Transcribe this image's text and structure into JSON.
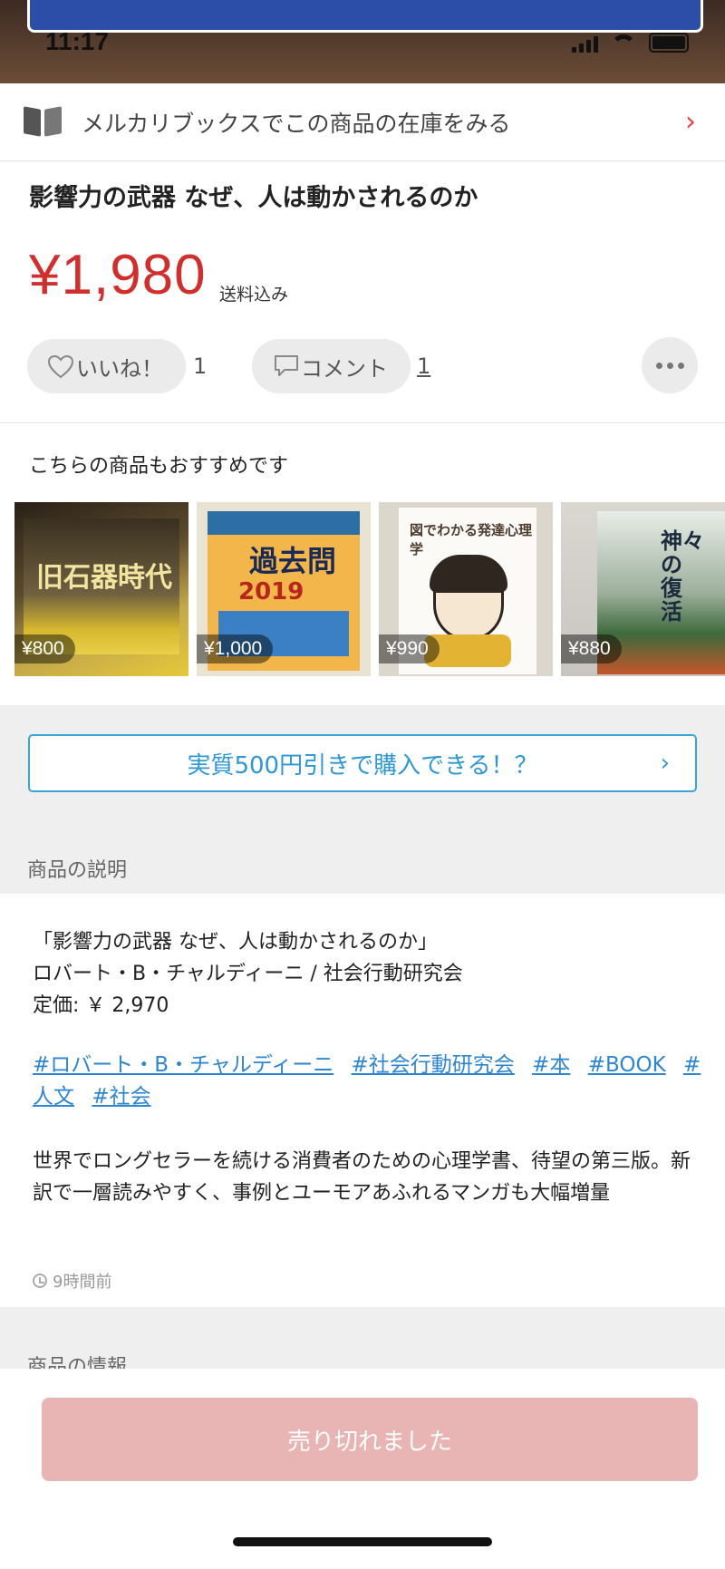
{
  "status_bar": {
    "time": "11:17"
  },
  "books_banner": {
    "label": "メルカリブックスでこの商品の在庫をみる"
  },
  "product": {
    "title": "影響力の武器 なぜ、人は動かされるのか",
    "price": "¥1,980",
    "shipping": "送料込み"
  },
  "actions": {
    "like_label": "いいね！",
    "like_count": "1",
    "comment_label": "コメント",
    "comment_count": "1"
  },
  "recommendations": {
    "heading": "こちらの商品もおすすめです",
    "items": [
      {
        "price": "¥800",
        "cover_text": "旧石器時代"
      },
      {
        "price": "¥1,000",
        "cover_text": "過去問",
        "cover_year": "2019"
      },
      {
        "price": "¥990",
        "cover_text": "図でわかる発達心理学"
      },
      {
        "price": "¥880",
        "cover_text": "神々の復活"
      }
    ]
  },
  "promo": {
    "label": "実質500円引きで購入できる！？"
  },
  "description": {
    "section_title": "商品の説明",
    "lines": [
      "「影響力の武器 なぜ、人は動かされるのか」",
      "ロバート・B・チャルディーニ / 社会行動研究会",
      "定価: ￥ 2,970"
    ],
    "tags": [
      "#ロバート・B・チャルディーニ",
      "#社会行動研究会",
      "#本",
      "#BOOK",
      "#人文",
      "#社会"
    ],
    "blurb": "世界でロングセラーを続ける消費者のための心理学書、待望の第三版。新訳で一層読みやすく、事例とユーモアあふれるマンガも大幅増量",
    "posted": "9時間前"
  },
  "info": {
    "section_title": "商品の情報"
  },
  "footer": {
    "sold_out_label": "売り切れました"
  },
  "colors": {
    "price": "#d0302d",
    "link": "#2f86d0",
    "cta": "#2f97d1",
    "sold_out": "#e8b4b4"
  }
}
